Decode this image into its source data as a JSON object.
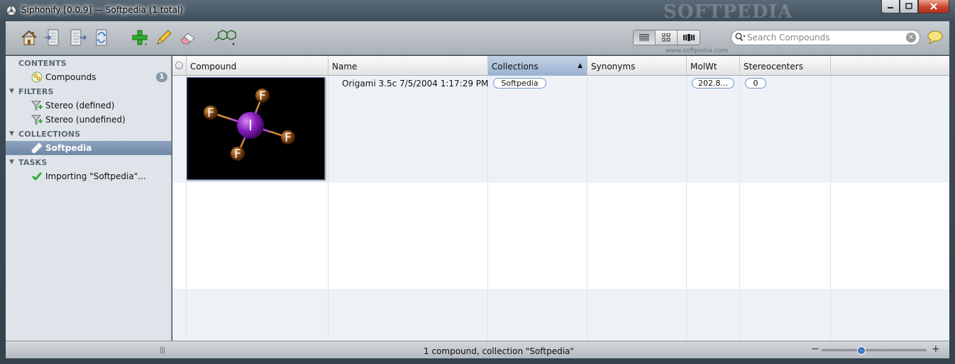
{
  "window": {
    "title": "Siphonify [0.0.9] — Softpedia (1 total)",
    "watermark": "SOFTPEDIA",
    "watermark_small": "www.softpedia.com"
  },
  "toolbar": {
    "search_placeholder": "Search Compounds",
    "view_modes": [
      "list-view-icon",
      "grid-view-icon",
      "coverflow-view-icon"
    ]
  },
  "sidebar": {
    "contents_header": "CONTENTS",
    "compounds_label": "Compounds",
    "compounds_count": "1",
    "filters_header": "FILTERS",
    "filter1": "Stereo (defined)",
    "filter2": "Stereo (undefined)",
    "collections_header": "COLLECTIONS",
    "collection1": "Softpedia",
    "tasks_header": "TASKS",
    "task1": "Importing \"Softpedia\"..."
  },
  "table": {
    "columns": {
      "compound": "Compound",
      "name": "Name",
      "collections": "Collections",
      "synonyms": "Synonyms",
      "molwt": "MolWt",
      "stereocenters": "Stereocenters"
    },
    "row": {
      "name": "Origami 3.5c 7/5/2004 1:17:29 PM",
      "collection": "Softpedia",
      "molwt": "202.8...",
      "stereocenters": "0"
    },
    "molecule": {
      "center_atom": "I",
      "ligand_atom": "F"
    }
  },
  "status": {
    "text": "1 compound,  collection \"Softpedia\"",
    "zoom_level": 0.38
  },
  "colors": {
    "selection": "#7a91b0",
    "sorted_header": "#a9bed8",
    "center_atom": "#8a1fc0",
    "ligand_atom": "#8a4b12"
  }
}
